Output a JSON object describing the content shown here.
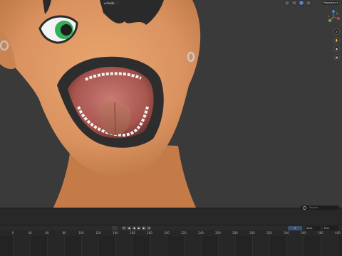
{
  "viewport": {
    "view_menu_label": "▾ mode",
    "overlay_label": "Properties ▾",
    "settings_label": "",
    "gizmo": {
      "x_label": "X",
      "y_label": "Y",
      "z_label": "Z"
    }
  },
  "nav_icons": [
    "⌕",
    "✋",
    "◉",
    "▦"
  ],
  "timeline": {
    "search_placeholder": "Search",
    "playback_buttons": [
      "⏮",
      "◀",
      "◀",
      "▶",
      "▶",
      "⏭"
    ],
    "current_frame": "1",
    "start": "Start",
    "end": "End",
    "ticks": [
      "0",
      "40",
      "60",
      "80",
      "100",
      "120",
      "140",
      "160",
      "180",
      "200",
      "220",
      "240",
      "260",
      "280",
      "300",
      "320",
      "340",
      "360",
      "380",
      "400"
    ]
  },
  "colors": {
    "skin": "#d99260",
    "skin_dark": "#b96f42",
    "lip": "#2d2d2d",
    "eye_iris": "#35b05a",
    "background": "#3d3d3d"
  }
}
